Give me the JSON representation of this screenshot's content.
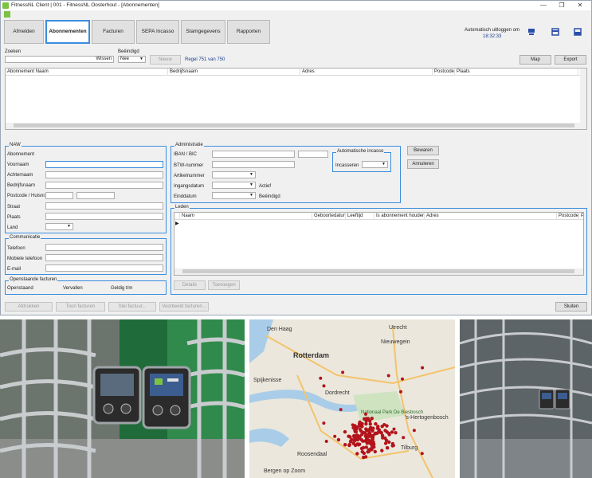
{
  "window": {
    "title": "FitnessNL Client | 001 - FitnessNL Oosterhout - [Abonnementen]",
    "controls": [
      "—",
      "❐",
      "✕"
    ]
  },
  "tabs": [
    {
      "label": "Afmelden"
    },
    {
      "label": "Abonnementen"
    },
    {
      "label": "Facturen"
    },
    {
      "label": "SEPA Incasso"
    },
    {
      "label": "Stamgegevens"
    },
    {
      "label": "Rapporten"
    }
  ],
  "header_right": {
    "autologout_label": "Automatisch uitloggen om",
    "autologout_time": "18:32:33"
  },
  "search": {
    "label": "Zoeken",
    "clear_button": "Wissen",
    "ended_label": "Beëindigd",
    "ended_value": "Nee",
    "new_button": "Nieuw",
    "row_info": "Regel 751 van 750",
    "map_button": "Map",
    "export_button": "Export"
  },
  "main_grid": {
    "columns": [
      "Abonnement Naam",
      "Bedrijfsnaam",
      "Adres",
      "Postcode",
      "Plaats"
    ]
  },
  "naw": {
    "title": "NAW",
    "fields": [
      "Abonnement",
      "Voornaam",
      "Achternaam",
      "Bedrijfsnaam",
      "Postcode / Huisnr.",
      "Straat",
      "Plaats",
      "Land"
    ]
  },
  "communicatie": {
    "title": "Communicatie",
    "fields": [
      "Telefoon",
      "Mobiele telefoon",
      "E-mail"
    ]
  },
  "facturen": {
    "title": "Openstaande facturen",
    "columns": [
      "Openstaand",
      "Vervallen",
      "Geldig t/m"
    ]
  },
  "administratie": {
    "title": "Administratie",
    "fields": [
      "IBAN / BIC",
      "BTW-nummer",
      "Artikelnummer",
      "Ingangsdatum",
      "Einddatum"
    ],
    "actief_label": "Actief",
    "beeindigd_label": "Beëindigd",
    "incasso_title": "Automatische incasso",
    "incasseren_label": "Incasseren"
  },
  "actions": {
    "save": "Bewaren",
    "cancel": "Annuleren"
  },
  "leden": {
    "title": "Leden",
    "columns": [
      "Naam",
      "Geboortedatum",
      "Leeftijd",
      "Is abonnement houder",
      "Adres",
      "Postcode",
      "Pl"
    ],
    "details_button": "Details",
    "add_button": "Toevoegen"
  },
  "footer": {
    "buttons": [
      "Afdrukken",
      "Toon facturen",
      "Stel factuur...",
      "Voorbeeld facturen..."
    ],
    "close_button": "Sluiten"
  },
  "map": {
    "cities": [
      "Den Haag",
      "Utrecht",
      "Nieuwegein",
      "Rotterdam",
      "Spijkenisse",
      "Dordrecht",
      "Nationaal Park De Biesbosch",
      "'s-Hertogenbosch",
      "Tilburg",
      "Roosendaal",
      "Bergen op Zoom"
    ]
  },
  "colors": {
    "accent": "#3a8dde",
    "brand": "#7cc242",
    "map_marker": "#b3131b"
  }
}
